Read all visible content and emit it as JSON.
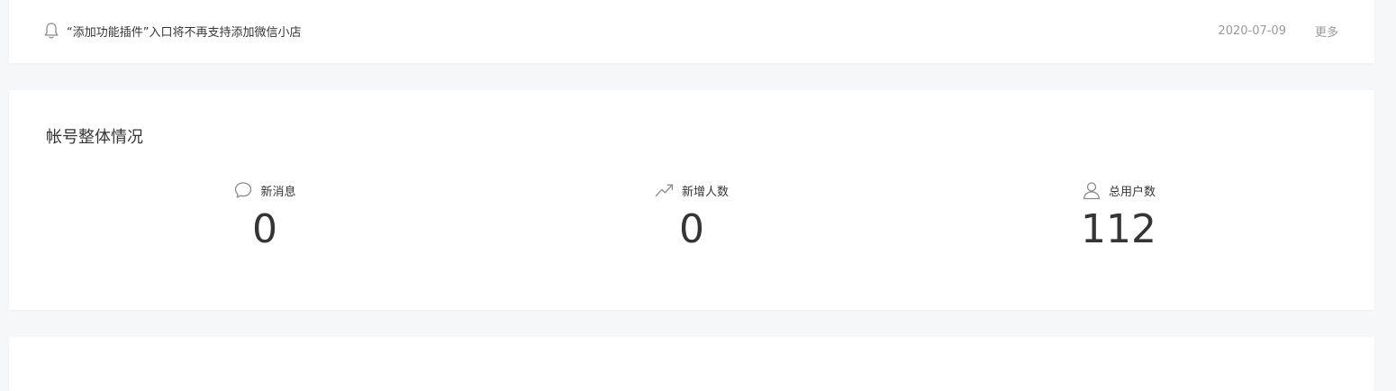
{
  "notice": {
    "text": "“添加功能插件”入口将不再支持添加微信小店",
    "date": "2020-07-09",
    "more_label": "更多"
  },
  "overview": {
    "title": "帐号整体情况",
    "stats": [
      {
        "icon": "chat-bubble-icon",
        "label": "新消息",
        "value": "0"
      },
      {
        "icon": "trend-up-icon",
        "label": "新增人数",
        "value": "0"
      },
      {
        "icon": "user-icon",
        "label": "总用户数",
        "value": "112"
      }
    ]
  }
}
